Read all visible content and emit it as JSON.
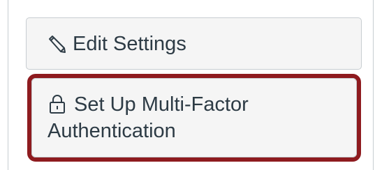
{
  "buttons": {
    "edit_settings": {
      "icon": "pencil-icon",
      "label": "Edit Settings"
    },
    "mfa": {
      "icon": "lock-icon",
      "label_line1": "Set Up Multi-Factor",
      "label_line2": "Authentication"
    }
  },
  "colors": {
    "button_bg": "#f5f5f5",
    "button_border": "#c7cdd1",
    "text": "#2d3b45",
    "highlight": "#8e1b1f"
  }
}
